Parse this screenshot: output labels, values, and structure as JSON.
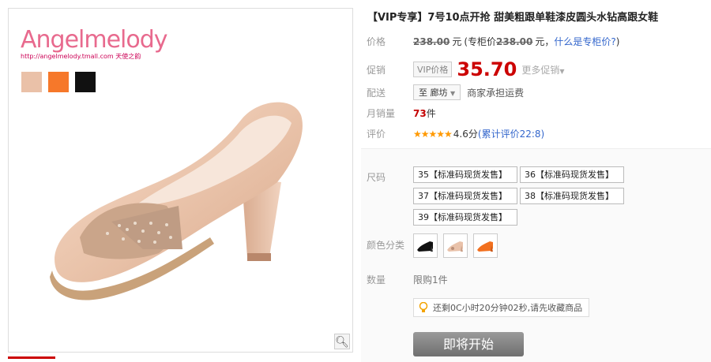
{
  "product_image": {
    "brand_logo": "Angelmelody",
    "brand_url": "http://angelmelody.tmall.com",
    "brand_cn": "天使之韵",
    "swatch_colors": [
      "#eac1a8",
      "#f6782a",
      "#111111"
    ],
    "zoom_icon": "magnifier-icon"
  },
  "product": {
    "title": "【VIP专享】7号10点开抢 甜美粗跟单鞋漆皮圆头水钻高跟女鞋",
    "price_label": "价格",
    "price_original": "238.00",
    "price_unit": "元",
    "price_note_prefix": "(专柜价",
    "price_counter": "238.00",
    "price_note_suffix": "元，",
    "counter_price_link": "什么是专柜价?",
    "price_note_close": ")",
    "promo_label": "促销",
    "vip_tag": "VIP价格",
    "promo_price": "35.70",
    "more_promo": "更多促销",
    "delivery_label": "配送",
    "delivery_to": "至 廊坊",
    "delivery_note": "商家承担运费",
    "sales_label": "月销量",
    "sales_count": "73",
    "sales_unit": "件",
    "rating_label": "评价",
    "rating_stars": "★★★★★",
    "rating_score": "4.6分",
    "review_link": "(累计评价22:8)"
  },
  "sku": {
    "size_label": "尺码",
    "sizes": [
      "35【标准码现货发售】",
      "36【标准码现货发售】",
      "37【标准码现货发售】",
      "38【标准码现货发售】",
      "39【标准码现货发售】"
    ],
    "color_label": "颜色分类",
    "colors": [
      "black",
      "nude",
      "orange"
    ],
    "quantity_label": "数量",
    "quantity_limit": "限购1件",
    "notice": "还剩0C小时20分钟02秒,请先收藏商品",
    "start_button": "即将开始"
  }
}
